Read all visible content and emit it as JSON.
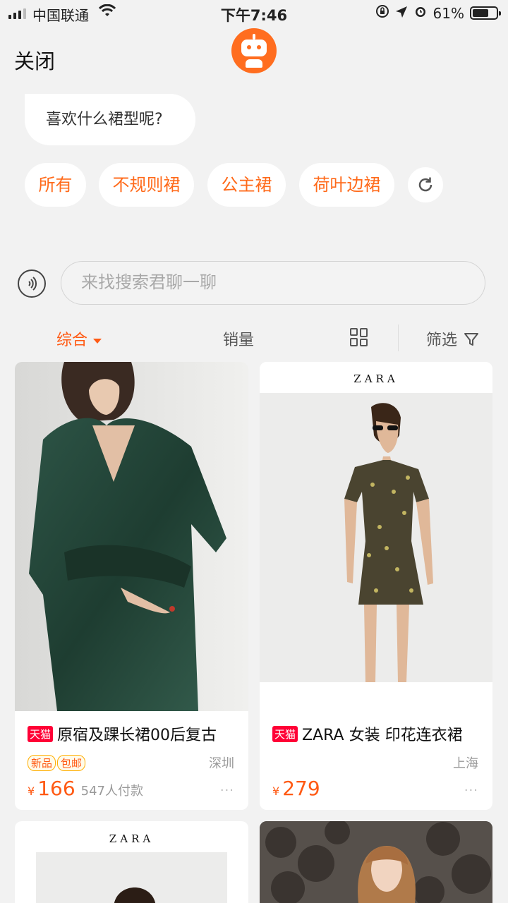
{
  "status_bar": {
    "carrier": "中国联通",
    "time": "下午7:46",
    "battery": "61%"
  },
  "header": {
    "close_label": "关闭"
  },
  "chat": {
    "question": "喜欢什么裙型呢?",
    "chips": [
      "所有",
      "不规则裙",
      "公主裙",
      "荷叶边裙"
    ]
  },
  "search": {
    "placeholder": "来找搜索君聊一聊"
  },
  "sort": {
    "comprehensive": "综合",
    "sales": "销量",
    "filter": "筛选"
  },
  "colors": {
    "accent": "#ff5a14",
    "tmall": "#ff0036",
    "background": "#f2f2f2"
  },
  "products": [
    {
      "badge": "天猫",
      "title": "原宿及踝长裙00后复古",
      "tags": [
        "新品",
        "包邮"
      ],
      "location": "深圳",
      "currency": "¥",
      "price": "166",
      "sold": "547人付款",
      "more": "···"
    },
    {
      "brand_logo": "ZARA",
      "badge": "天猫",
      "title": "ZARA  女装 印花连衣裙",
      "tags": [],
      "location": "上海",
      "currency": "¥",
      "price": "279",
      "sold": "",
      "more": "···"
    },
    {
      "brand_logo": "ZARA"
    }
  ]
}
